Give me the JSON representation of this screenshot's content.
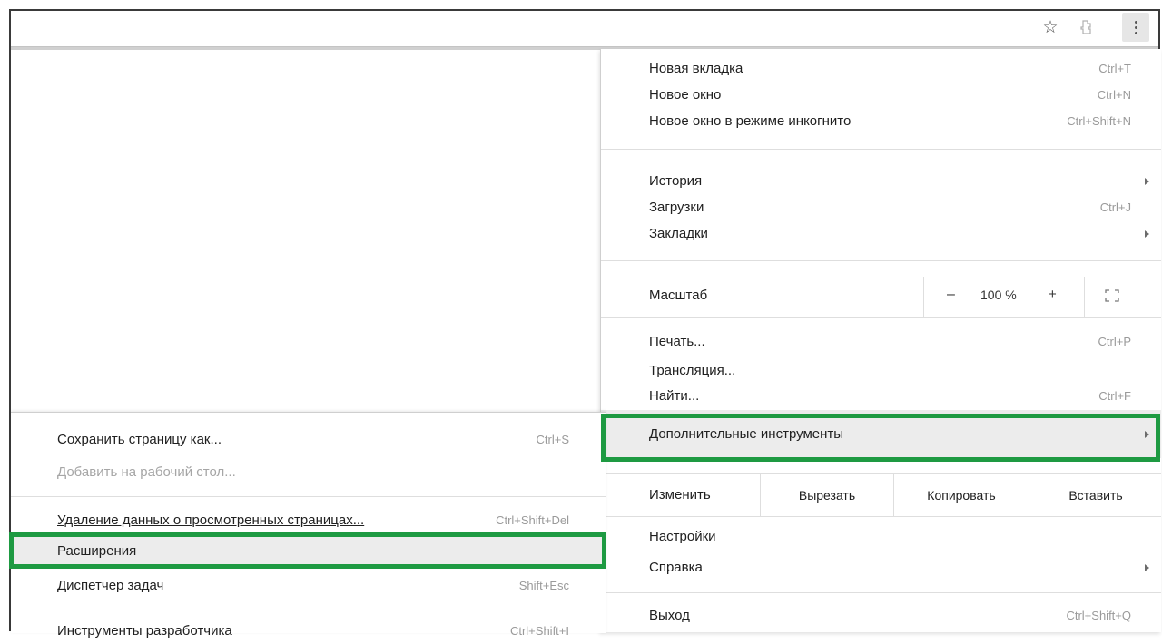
{
  "toolbar": {
    "star_icon": "star-icon",
    "extension_icon": "extension-icon",
    "menu_icon": "kebab-menu-icon"
  },
  "menu": {
    "new_tab": {
      "label": "Новая вкладка",
      "shortcut": "Ctrl+T"
    },
    "new_window": {
      "label": "Новое окно",
      "shortcut": "Ctrl+N"
    },
    "incognito": {
      "label": "Новое окно в режиме инкогнито",
      "shortcut": "Ctrl+Shift+N"
    },
    "history": {
      "label": "История"
    },
    "downloads": {
      "label": "Загрузки",
      "shortcut": "Ctrl+J"
    },
    "bookmarks": {
      "label": "Закладки"
    },
    "zoom": {
      "label": "Масштаб",
      "minus": "–",
      "value": "100 %",
      "plus": "+"
    },
    "print": {
      "label": "Печать...",
      "shortcut": "Ctrl+P"
    },
    "cast": {
      "label": "Трансляция..."
    },
    "find": {
      "label": "Найти...",
      "shortcut": "Ctrl+F"
    },
    "more_tools": {
      "label": "Дополнительные инструменты"
    },
    "edit": {
      "label": "Изменить",
      "cut": "Вырезать",
      "copy": "Копировать",
      "paste": "Вставить"
    },
    "settings": {
      "label": "Настройки"
    },
    "help": {
      "label": "Справка"
    },
    "exit": {
      "label": "Выход",
      "shortcut": "Ctrl+Shift+Q"
    }
  },
  "submenu": {
    "save_page": {
      "label": "Сохранить страницу как...",
      "shortcut": "Ctrl+S"
    },
    "add_to_desktop": {
      "label": "Добавить на рабочий стол..."
    },
    "clear_data": {
      "label": "Удаление данных о просмотренных страницах...",
      "shortcut": "Ctrl+Shift+Del"
    },
    "extensions": {
      "label": "Расширения"
    },
    "task_manager": {
      "label": "Диспетчер задач",
      "shortcut": "Shift+Esc"
    },
    "dev_tools": {
      "label": "Инструменты разработчика",
      "shortcut": "Ctrl+Shift+I"
    }
  },
  "colors": {
    "highlight_border": "#1e9a42",
    "hover_bg": "#ececec"
  }
}
